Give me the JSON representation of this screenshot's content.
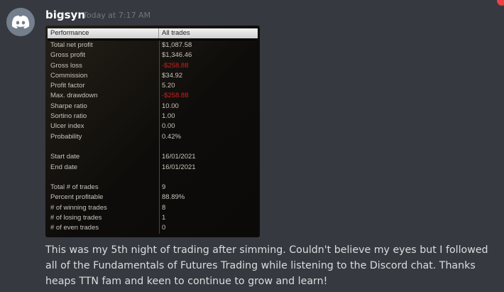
{
  "message": {
    "username": "bigsyn",
    "timestamp": "Today at 7:17 AM",
    "text": "This was my 5th night of trading after simming. Couldn't believe my eyes but I followed all of the Fundamentals of Futures Trading while listening to the Discord chat. Thanks heaps TTN fam and keen to continue to grow and learn!",
    "avatar_icon": "discord-logo-icon"
  },
  "colors": {
    "background": "#36393f",
    "negative_value": "#d21f1f",
    "avatar_bg": "#747f8d"
  },
  "performance": {
    "header_label": "Performance",
    "header_value": "All trades",
    "rows": [
      {
        "label": "Total net profit",
        "value": "$1,087.58"
      },
      {
        "label": "Gross profit",
        "value": "$1,346.46"
      },
      {
        "label": "Gross loss",
        "value": "-$258.88",
        "negative": true
      },
      {
        "label": "Commission",
        "value": "$34.92"
      },
      {
        "label": "Profit factor",
        "value": "5.20"
      },
      {
        "label": "Max. drawdown",
        "value": "-$258.88",
        "negative": true
      },
      {
        "label": "Sharpe ratio",
        "value": "10.00"
      },
      {
        "label": "Sortino ratio",
        "value": "1.00"
      },
      {
        "label": "Ulcer index",
        "value": "0.00"
      },
      {
        "label": "Probability",
        "value": "0.42%"
      },
      {
        "gap": true
      },
      {
        "label": "Start date",
        "value": "16/01/2021"
      },
      {
        "label": "End date",
        "value": "16/01/2021"
      },
      {
        "gap": true
      },
      {
        "label": "Total # of trades",
        "value": "9"
      },
      {
        "label": "Percent profitable",
        "value": "88.89%"
      },
      {
        "label": "# of winning trades",
        "value": "8"
      },
      {
        "label": "# of losing trades",
        "value": "1"
      },
      {
        "label": "# of even trades",
        "value": "0"
      }
    ]
  }
}
